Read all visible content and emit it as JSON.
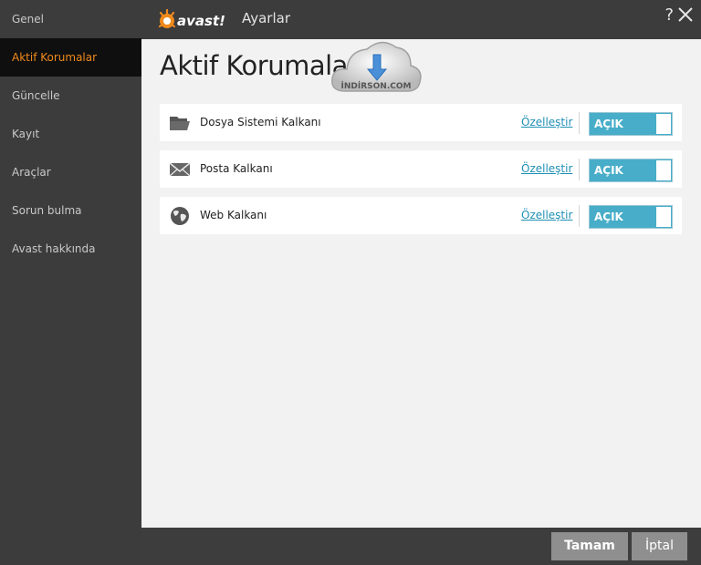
{
  "sidebar": {
    "items": [
      {
        "label": "Genel"
      },
      {
        "label": "Aktif Korumalar",
        "active": true
      },
      {
        "label": "Güncelle"
      },
      {
        "label": "Kayıt"
      },
      {
        "label": "Araçlar"
      },
      {
        "label": "Sorun bulma"
      },
      {
        "label": "Avast hakkında"
      }
    ]
  },
  "header": {
    "logo_text": "avast!",
    "title": "Ayarlar",
    "help_label": "?"
  },
  "main": {
    "title": "Aktif Korumalar",
    "watermark_text": "İNDİRSON.COM",
    "shields": [
      {
        "label": "Dosya Sistemi Kalkanı",
        "link": "Özelleştir",
        "toggle": "AÇIK",
        "icon": "folder-icon"
      },
      {
        "label": "Posta Kalkanı",
        "link": "Özelleştir",
        "toggle": "AÇIK",
        "icon": "mail-icon"
      },
      {
        "label": "Web Kalkanı",
        "link": "Özelleştir",
        "toggle": "AÇIK",
        "icon": "globe-icon"
      }
    ]
  },
  "footer": {
    "ok_label": "Tamam",
    "cancel_label": "İptal"
  },
  "colors": {
    "accent": "#f08a1c",
    "toggle_on": "#47adc8",
    "link": "#1f8fb4"
  }
}
